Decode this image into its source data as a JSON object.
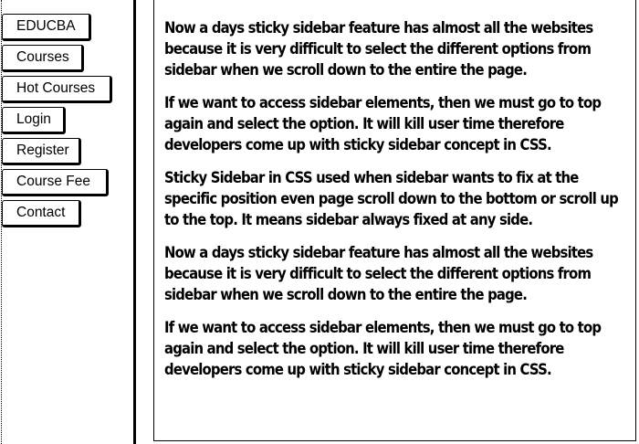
{
  "sidebar": {
    "items": [
      {
        "label": "EDUCBA"
      },
      {
        "label": "Courses"
      },
      {
        "label": "Hot Courses"
      },
      {
        "label": "Login"
      },
      {
        "label": "Register"
      },
      {
        "label": "Course Fee"
      },
      {
        "label": "Contact"
      }
    ]
  },
  "content": {
    "paragraphs": [
      "Now a days sticky sidebar feature has almost all the websites because it is very difficult to select the different options from sidebar when we scroll down to the entire the page.",
      "If we want to access sidebar elements, then we must go to top again and select the option. It will kill user time therefore developers come up with sticky sidebar concept in CSS.",
      "Sticky Sidebar in CSS used when sidebar wants to fix at the specific position even page scroll down to the bottom or scroll up to the top. It means sidebar always fixed at any side.",
      "Now a days sticky sidebar feature has almost all the websites because it is very difficult to select the different options from sidebar when we scroll down to the entire the page.",
      "If we want to access sidebar elements, then we must go to top again and select the option. It will kill user time therefore developers come up with sticky sidebar concept in CSS."
    ]
  }
}
